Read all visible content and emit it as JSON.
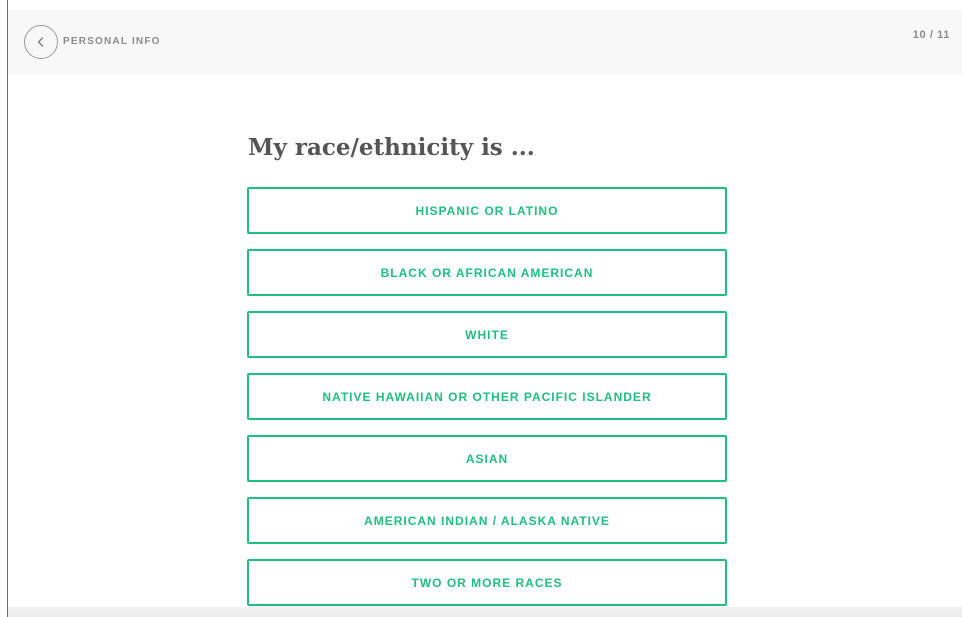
{
  "header": {
    "section_title": "PERSONAL INFO",
    "progress": "10 / 11",
    "back_icon": "chevron-left-icon"
  },
  "question": {
    "text": "My race/ethnicity is ..."
  },
  "options": [
    {
      "label": "HISPANIC OR LATINO"
    },
    {
      "label": "BLACK OR AFRICAN AMERICAN"
    },
    {
      "label": "WHITE"
    },
    {
      "label": "NATIVE HAWAIIAN OR OTHER PACIFIC ISLANDER"
    },
    {
      "label": "ASIAN"
    },
    {
      "label": "AMERICAN INDIAN / ALASKA NATIVE"
    },
    {
      "label": "TWO OR MORE RACES"
    }
  ],
  "colors": {
    "accent": "#1fbf7f",
    "header_bg": "#f8f8f8",
    "muted_text": "#8c8c8c",
    "question_text": "#555555"
  }
}
